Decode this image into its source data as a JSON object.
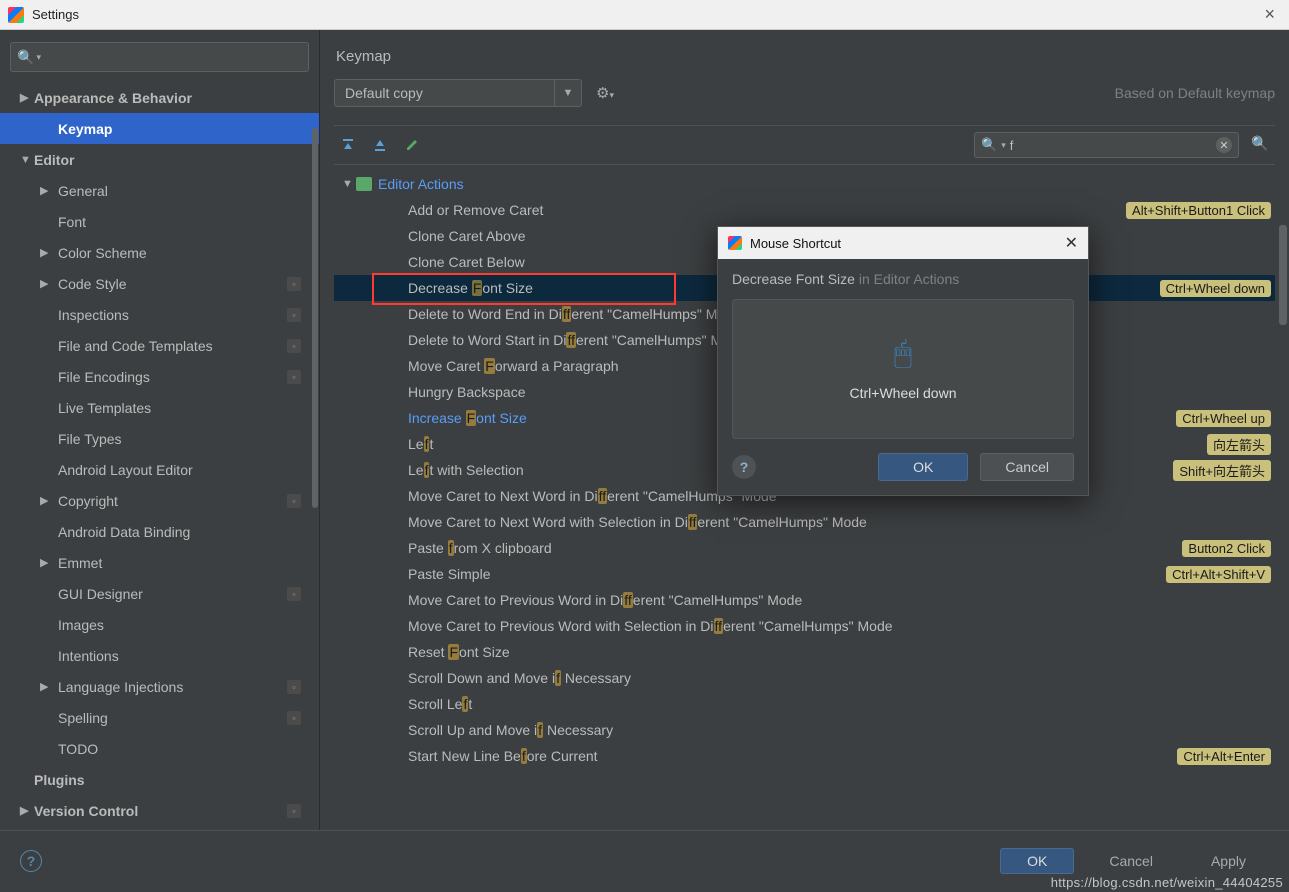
{
  "window": {
    "title": "Settings"
  },
  "sidebar": {
    "items": [
      {
        "label": "Appearance & Behavior",
        "arrow": "▶",
        "top": true
      },
      {
        "label": "Keymap",
        "selected": true,
        "indent": 1
      },
      {
        "label": "Editor",
        "arrow": "▼",
        "top": true
      },
      {
        "label": "General",
        "arrow": "▶",
        "indent": 1
      },
      {
        "label": "Font",
        "indent": 1
      },
      {
        "label": "Color Scheme",
        "arrow": "▶",
        "indent": 1
      },
      {
        "label": "Code Style",
        "arrow": "▶",
        "indent": 1,
        "badge": true
      },
      {
        "label": "Inspections",
        "indent": 1,
        "badge": true
      },
      {
        "label": "File and Code Templates",
        "indent": 1,
        "badge": true
      },
      {
        "label": "File Encodings",
        "indent": 1,
        "badge": true
      },
      {
        "label": "Live Templates",
        "indent": 1
      },
      {
        "label": "File Types",
        "indent": 1
      },
      {
        "label": "Android Layout Editor",
        "indent": 1
      },
      {
        "label": "Copyright",
        "arrow": "▶",
        "indent": 1,
        "badge": true
      },
      {
        "label": "Android Data Binding",
        "indent": 1
      },
      {
        "label": "Emmet",
        "arrow": "▶",
        "indent": 1
      },
      {
        "label": "GUI Designer",
        "indent": 1,
        "badge": true
      },
      {
        "label": "Images",
        "indent": 1
      },
      {
        "label": "Intentions",
        "indent": 1
      },
      {
        "label": "Language Injections",
        "arrow": "▶",
        "indent": 1,
        "badge": true
      },
      {
        "label": "Spelling",
        "indent": 1,
        "badge": true
      },
      {
        "label": "TODO",
        "indent": 1
      },
      {
        "label": "Plugins",
        "top": true
      },
      {
        "label": "Version Control",
        "arrow": "▶",
        "top": true,
        "badge": true
      }
    ]
  },
  "content": {
    "heading": "Keymap",
    "scheme": "Default copy",
    "based": "Based on Default keymap",
    "filter": "f",
    "group": "Editor Actions",
    "actions": [
      {
        "label": "Add or Remove Caret",
        "shortcut": "Alt+Shift+Button1 Click"
      },
      {
        "label": "Clone Caret Above"
      },
      {
        "label": "Clone Caret Below"
      },
      {
        "label": "Decrease Font Size",
        "selected": true,
        "boxed": true,
        "shortcut": "Ctrl+Wheel down"
      },
      {
        "label": "Delete to Word End in Different \"CamelHumps\" Mode"
      },
      {
        "label": "Delete to Word Start in Different \"CamelHumps\" Mode"
      },
      {
        "label": "Move Caret Forward a Paragraph"
      },
      {
        "label": "Hungry Backspace"
      },
      {
        "label": "Increase Font Size",
        "blue": true,
        "shortcut": "Ctrl+Wheel up"
      },
      {
        "label": "Left",
        "shortcut": "向左箭头"
      },
      {
        "label": "Left with Selection",
        "shortcut": "Shift+向左箭头"
      },
      {
        "label": "Move Caret to Next Word in Different \"CamelHumps\" Mode"
      },
      {
        "label": "Move Caret to Next Word with Selection in Different \"CamelHumps\" Mode"
      },
      {
        "label": "Paste from X clipboard",
        "shortcut": "Button2 Click"
      },
      {
        "label": "Paste Simple",
        "shortcut": "Ctrl+Alt+Shift+V"
      },
      {
        "label": "Move Caret to Previous Word in Different \"CamelHumps\" Mode"
      },
      {
        "label": "Move Caret to Previous Word with Selection in Different \"CamelHumps\" Mode"
      },
      {
        "label": "Reset Font Size"
      },
      {
        "label": "Scroll Down and Move if Necessary"
      },
      {
        "label": "Scroll Left"
      },
      {
        "label": "Scroll Up and Move if Necessary"
      },
      {
        "label": "Start New Line Before Current",
        "shortcut": "Ctrl+Alt+Enter"
      }
    ]
  },
  "footer": {
    "ok": "OK",
    "cancel": "Cancel",
    "apply": "Apply"
  },
  "dialog": {
    "title": "Mouse Shortcut",
    "action": "Decrease Font Size",
    "in": "in Editor Actions",
    "shortcut": "Ctrl+Wheel down",
    "ok": "OK",
    "cancel": "Cancel"
  },
  "watermark": "https://blog.csdn.net/weixin_44404255"
}
